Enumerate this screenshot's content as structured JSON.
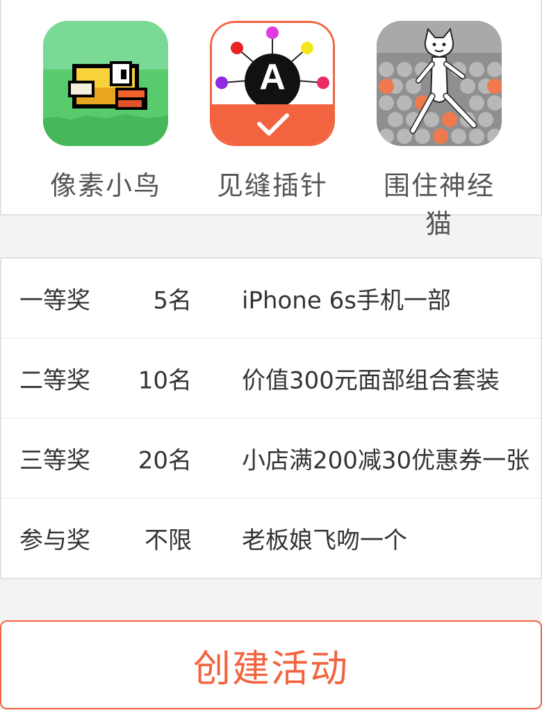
{
  "games": [
    {
      "name": "像素小鸟",
      "icon": "flappy-bird-icon"
    },
    {
      "name": "见缝插针",
      "icon": "pin-game-icon",
      "selected": true,
      "badge_letter": "A"
    },
    {
      "name": "围住神经猫",
      "icon": "crazy-cat-icon"
    }
  ],
  "prizes": [
    {
      "level": "一等奖",
      "count": "5名",
      "prize": "iPhone 6s手机一部"
    },
    {
      "level": "二等奖",
      "count": "10名",
      "prize": "价值300元面部组合套装"
    },
    {
      "level": "三等奖",
      "count": "20名",
      "prize": "小店满200减30优惠券一张"
    },
    {
      "level": "参与奖",
      "count": "不限",
      "prize": "老板娘飞吻一个"
    }
  ],
  "create_button": "创建活动",
  "colors": {
    "accent": "#f26440",
    "background": "#f3f3f3",
    "text": "#333333"
  }
}
